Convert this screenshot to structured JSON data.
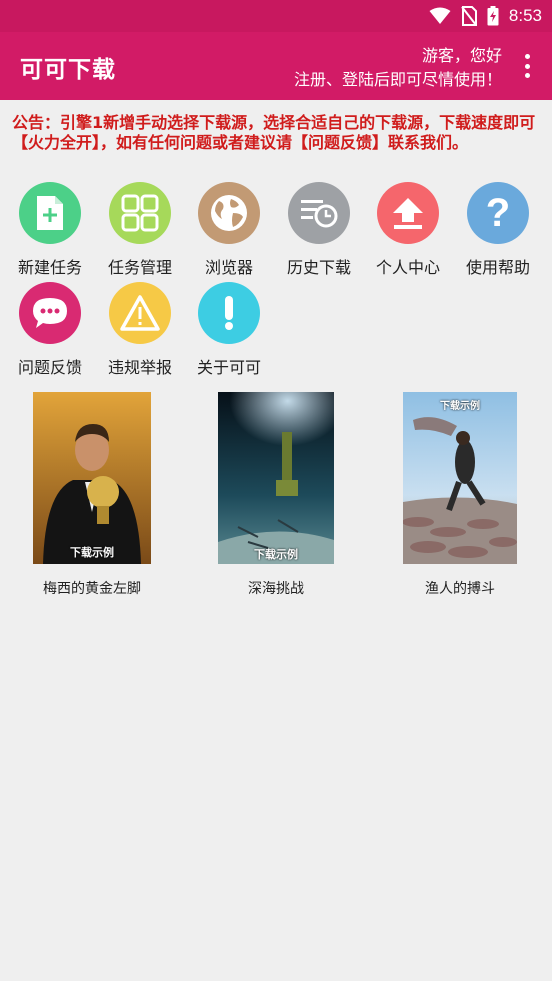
{
  "status": {
    "time": "8:53"
  },
  "app": {
    "title": "可可下载",
    "user_line1": "游客，您好",
    "user_line2": "注册、登陆后即可尽情使用！"
  },
  "notice": "公告：引擎1新增手动选择下载源，选择合适自己的下载源，下载速度即可【火力全开】，如有任何问题或者建议请【问题反馈】联系我们。",
  "menu": [
    {
      "label": "新建任务",
      "icon": "new-task-icon",
      "color": "#4cd088"
    },
    {
      "label": "任务管理",
      "icon": "task-grid-icon",
      "color": "#a6d95a"
    },
    {
      "label": "浏览器",
      "icon": "globe-icon",
      "color": "#c29a74"
    },
    {
      "label": "历史下载",
      "icon": "history-icon",
      "color": "#9ea1a5"
    },
    {
      "label": "个人中心",
      "icon": "upload-arrow-icon",
      "color": "#f5666c"
    },
    {
      "label": "使用帮助",
      "icon": "question-icon",
      "color": "#6aa9dc"
    },
    {
      "label": "问题反馈",
      "icon": "chat-bubble-icon",
      "color": "#d92a72"
    },
    {
      "label": "违规举报",
      "icon": "warning-icon",
      "color": "#f6c946"
    },
    {
      "label": "关于可可",
      "icon": "info-exclamation-icon",
      "color": "#3dcde3"
    }
  ],
  "examples": [
    {
      "title": "梅西的黄金左脚",
      "watermark": "下载示例"
    },
    {
      "title": "深海挑战",
      "watermark": "下载示例"
    },
    {
      "title": "渔人的搏斗",
      "watermark": "下载示例"
    }
  ],
  "colors": {
    "status_bar": "#c8185f",
    "app_bar": "#d21b66",
    "notice_text": "#d01c1c"
  }
}
